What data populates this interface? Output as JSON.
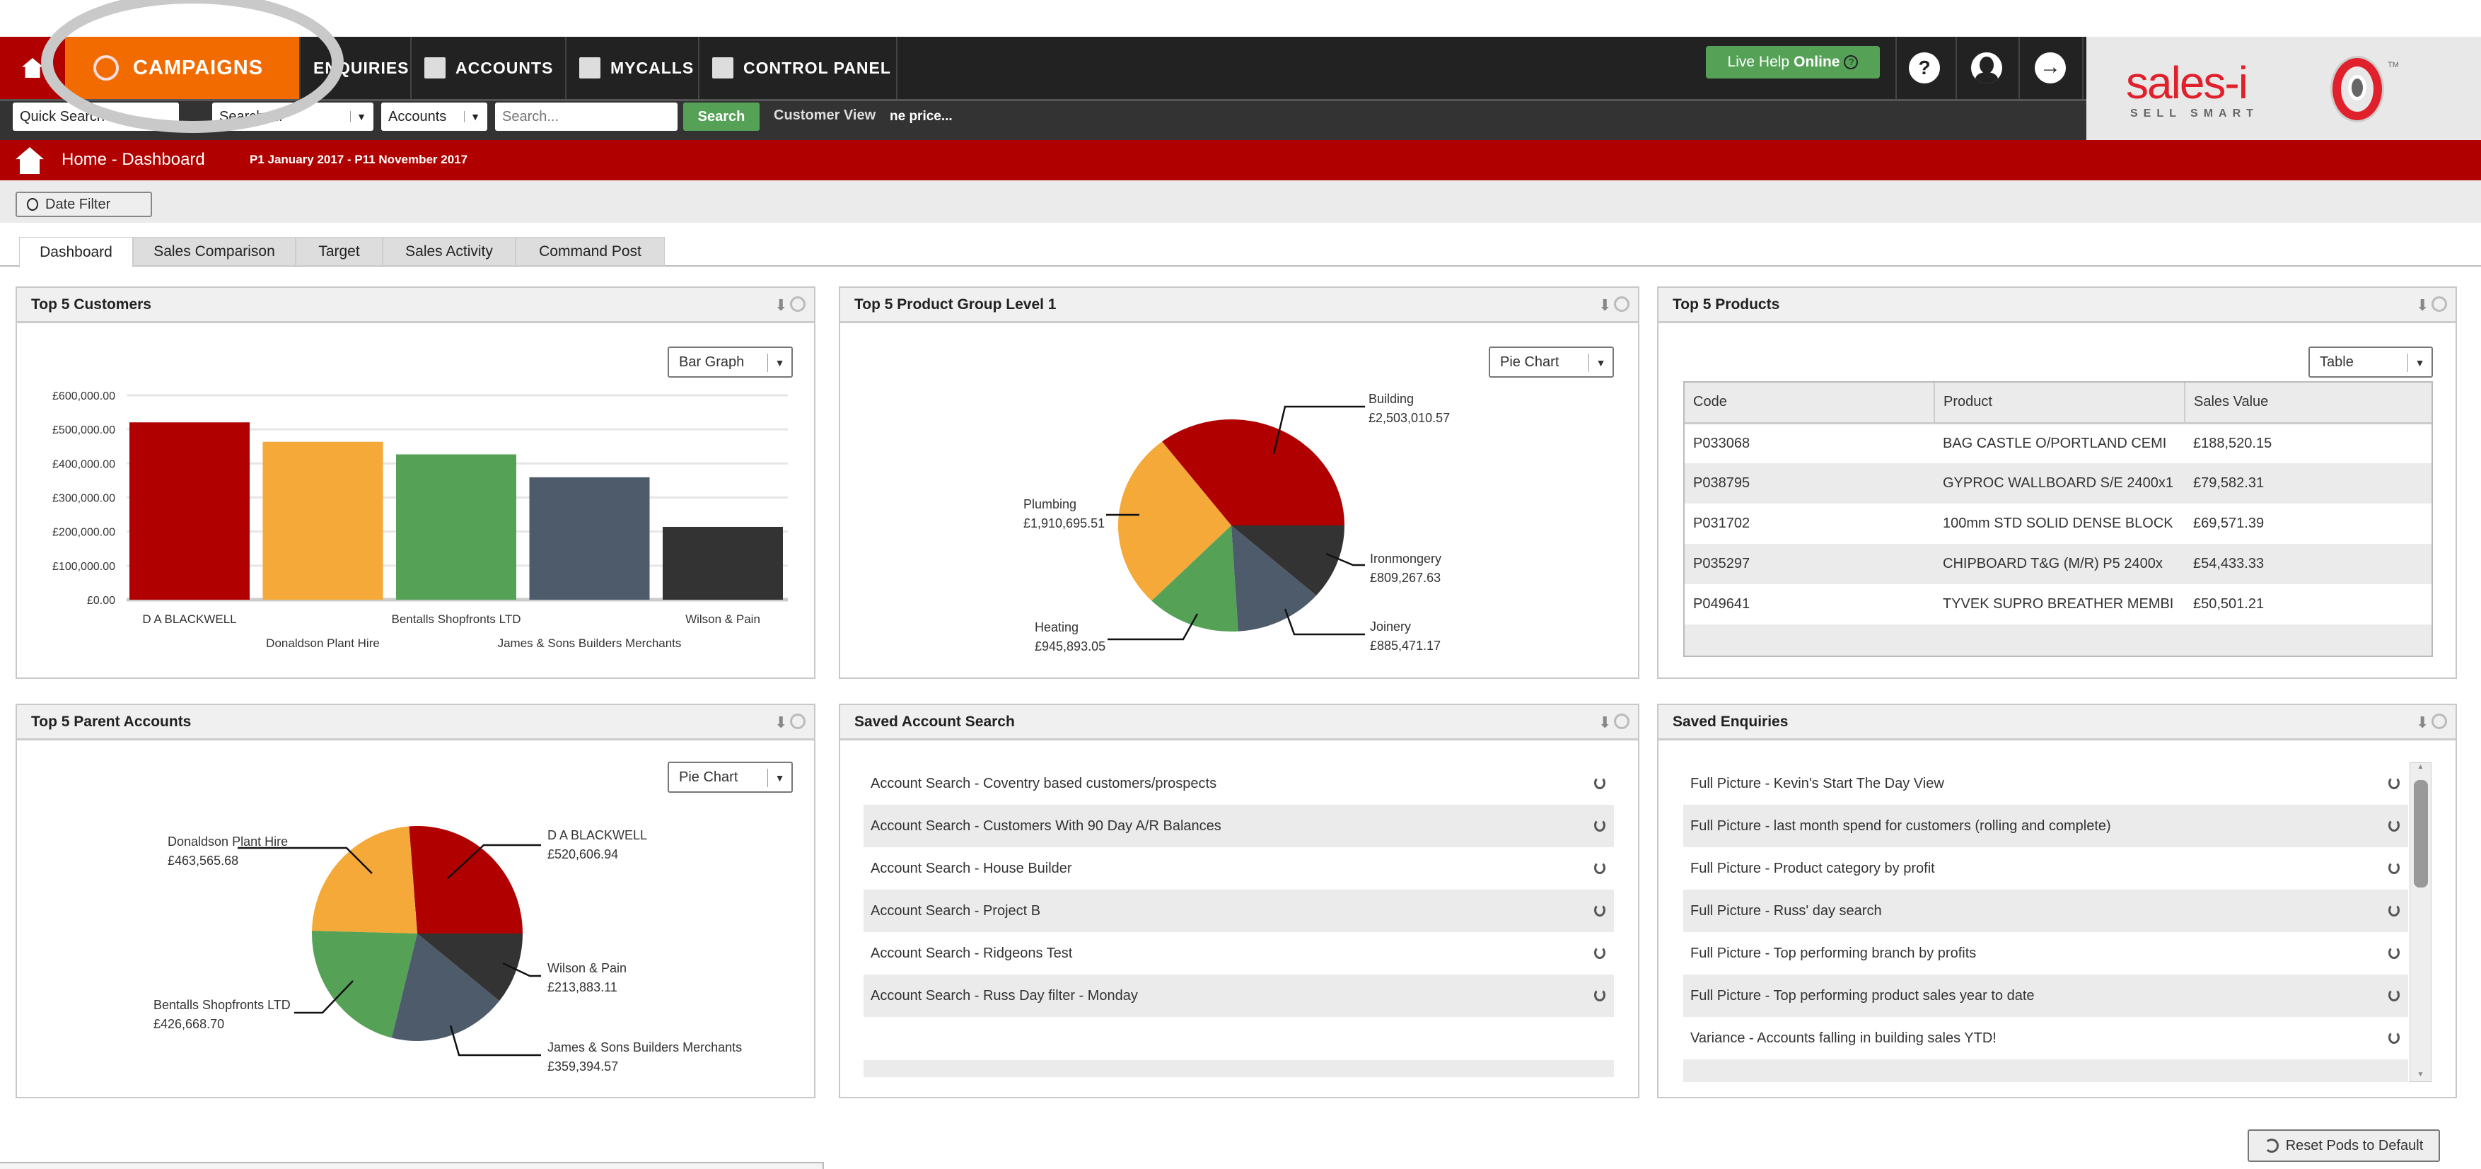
{
  "nav": {
    "items": [
      {
        "label": "CAMPAIGNS"
      },
      {
        "label": "ENQUIRIES"
      },
      {
        "label": "ACCOUNTS"
      },
      {
        "label": "MYCALLS"
      },
      {
        "label": "CONTROL PANEL"
      }
    ],
    "live_help": {
      "label": "Live Help",
      "status": "Online"
    },
    "brand_color": "#b00000",
    "active_color": "#f26b00"
  },
  "logo": {
    "name": "sales-i",
    "tagline": "SELL SMART",
    "tm": "TM"
  },
  "subbar": {
    "quick_select": "Quick Search",
    "scope_select": "Search all",
    "type_select": "Accounts",
    "search_placeholder": "Search...",
    "search_button": "Search",
    "customer_view": "Customer View",
    "ticker": "ne price..."
  },
  "breadcrumb": {
    "title": "Home - Dashboard",
    "date_range": "P1 January 2017 - P11 November 2017"
  },
  "date_filter": "Date Filter",
  "tabs": [
    {
      "label": "Dashboard",
      "active": true
    },
    {
      "label": "Sales Comparison"
    },
    {
      "label": "Target"
    },
    {
      "label": "Sales Activity"
    },
    {
      "label": "Command Post"
    }
  ],
  "pods": {
    "top_customers": {
      "title": "Top 5 Customers",
      "view": "Bar Graph"
    },
    "product_group": {
      "title": "Top 5 Product Group Level 1",
      "view": "Pie Chart"
    },
    "top_products": {
      "title": "Top 5 Products",
      "view": "Table",
      "columns": [
        "Code",
        "Product",
        "Sales Value"
      ],
      "rows": [
        [
          "P033068",
          "BAG CASTLE O/PORTLAND CEMI",
          "£188,520.15"
        ],
        [
          "P038795",
          "GYPROC WALLBOARD S/E 2400x1",
          "£79,582.31"
        ],
        [
          "P031702",
          "100mm STD SOLID DENSE BLOCK",
          "£69,571.39"
        ],
        [
          "P035297",
          "CHIPBOARD T&G (M/R) P5 2400x",
          "£54,433.33"
        ],
        [
          "P049641",
          "TYVEK SUPRO BREATHER MEMBI",
          "£50,501.21"
        ]
      ]
    },
    "parent_accounts": {
      "title": "Top 5 Parent Accounts",
      "view": "Pie Chart"
    },
    "saved_account_search": {
      "title": "Saved Account Search",
      "items": [
        "Account Search - Coventry based customers/prospects",
        "Account Search - Customers With 90 Day A/R Balances",
        "Account Search - House Builder",
        "Account Search - Project B",
        "Account Search - Ridgeons Test",
        "Account Search - Russ Day filter - Monday"
      ]
    },
    "saved_enquiries": {
      "title": "Saved Enquiries",
      "items": [
        "Full Picture - Kevin's Start The Day View",
        "Full Picture - last month spend for customers (rolling and complete)",
        "Full Picture - Product category by profit",
        "Full Picture - Russ' day search",
        "Full Picture - Top performing branch by profits",
        "Full Picture - Top performing product sales year to date",
        "Variance - Accounts falling in building sales YTD!"
      ]
    }
  },
  "reset_button": "Reset Pods to Default",
  "chart_data": [
    {
      "type": "bar",
      "categories": [
        "D A BLACKWELL",
        "Donaldson Plant Hire",
        "Bentalls Shopfronts LTD",
        "James & Sons Builders Merchants",
        "Wilson & Pain"
      ],
      "values": [
        520606.94,
        463565.68,
        426668.7,
        359394.57,
        213883.11
      ],
      "yticks": [
        "£0.00",
        "£100,000.00",
        "£200,000.00",
        "£300,000.00",
        "£400,000.00",
        "£500,000.00",
        "£600,000.00"
      ],
      "ylim": [
        0,
        600000
      ],
      "grid": true,
      "colors": [
        "#b00000",
        "#f4a938",
        "#55a257",
        "#4e5b6b",
        "#333333"
      ]
    },
    {
      "type": "pie",
      "labels": [
        "Building",
        "Plumbing",
        "Heating",
        "Joinery",
        "Ironmongery"
      ],
      "values": [
        2503010.57,
        1910695.51,
        945893.05,
        885471.17,
        809267.63
      ],
      "value_labels": [
        "£2,503,010.57",
        "£1,910,695.51",
        "£945,893.05",
        "£885,471.17",
        "£809,267.63"
      ],
      "colors": [
        "#b00000",
        "#f4a938",
        "#55a257",
        "#4e5b6b",
        "#333333"
      ]
    },
    {
      "type": "pie",
      "labels": [
        "D A BLACKWELL",
        "Donaldson Plant Hire",
        "Bentalls Shopfronts LTD",
        "James & Sons Builders Merchants",
        "Wilson & Pain"
      ],
      "values": [
        520606.94,
        463565.68,
        426668.7,
        359394.57,
        213883.11
      ],
      "value_labels": [
        "£520,606.94",
        "£463,565.68",
        "£426,668.70",
        "£359,394.57",
        "£213,883.11"
      ],
      "colors": [
        "#b00000",
        "#f4a938",
        "#55a257",
        "#4e5b6b",
        "#333333"
      ]
    }
  ]
}
